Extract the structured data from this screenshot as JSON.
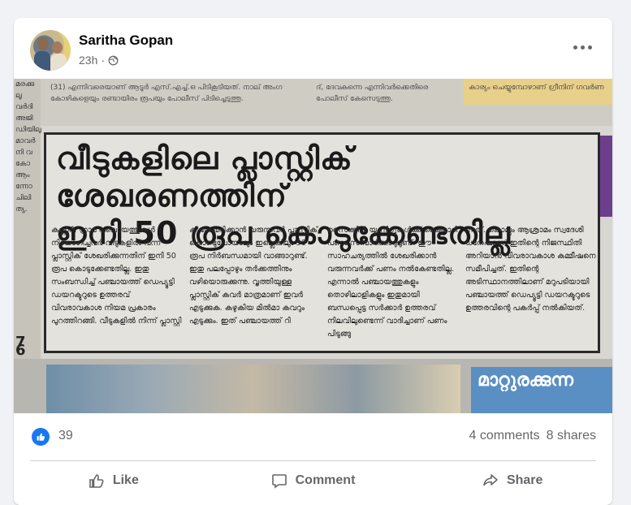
{
  "post": {
    "author": "Saritha Gopan",
    "time": "23h",
    "separator": "·",
    "privacy_icon": "globe-icon",
    "more_icon": "ellipsis-icon"
  },
  "newspaper": {
    "headline_line1": "വീടുകളിലെ പ്ലാസ്റ്റിക് ശേഖരണത്തിന്",
    "headline_line2": "ഇനി 50 രൂപ കൊടുക്കേണ്ടതില്ല",
    "top_snippet_left": "(31) എന്നിവരെയാണ് ആടൂർ എസ്.എച്ച്.ഒ പിടികൂടിയത്. നാല് അംഗ കോഴികളെയും രണ്ടായിരം രൂപയും പോലീസ് പിടിച്ചെടുത്തു.",
    "top_snippet_mid": "ദ്, ദേവകന്നെ എന്നിവർക്കെതിരെ പോലീസ് കേസെടുത്തു.",
    "top_snippet_right": "കാര്യം ചെയ്യുമ്പോഴാണ് ഗ്രീനിന് ഗവർണ",
    "col1": "കണ്ണൂർ: ഗ്രാമ പഞ്ചായത്തുകൾ നിയോഗിച്ചവർ വീടുകളിൽ വന്ന് പ്ലാസ്റ്റിക് ശേഖരിക്കുന്നതിന് ഇനി 50 രൂപ കൊടുക്കേണ്ടതില്ല. ഇതു സംബന്ധിച്ച് പഞ്ചായത്ത് ഡെപ്യൂട്ടി ഡയറക്ടറുടെ ഉത്തരവ് വിവരാവകാശ നിയമ പ്രകാരം പുറത്തിറങ്ങി. വീടുകളിൽ നിന്ന് പ്ലാസ്റ്റി",
    "col2": "ക് ശേഖരിക്കാൻ വരുന്നവർ പ്ലാസ്റ്റിക് കൊണ്ടുപോയാലും ഇല്ലെങ്കിലും 50 രൂപ നിർബന്ധമായി വാങ്ങാറുണ്ട്. ഇതു പലപ്പോഴും തർക്കത്തിനും വഴിയൊരുക്കുന്നു. വൃത്തിയുള്ള പ്ലാസ്റ്റിക് കവർ മാത്രമാണ് ഇവർ എടുക്കുക. കഴുകിയ മിൽമാ കവറും എടുക്കും. ഇത് പഞ്ചായത്ത് റി",
    "col3": "സൈക്കിൾ യൂണിറ്റുകൾക്ക് കൈമാറി പണം സമ്പാദിക്കാറുമുണ്ട്. ഈ സാഹചര്യത്തിൽ ശേഖരിക്കാൻ വരുന്നവർക്ക് പണം നൽകേണ്ടതില്ല. എന്നാൽ പഞ്ചായത്തുകളും തൊഴിലാളികളും ഇതുമായി ബന്ധപ്പെട്ട സർക്കാർ ഉത്തരവ് നിലവിലുണ്ടെന്ന് വാദിച്ചാണ് പണം പിടുങ്ങു",
    "col4": "ന്നത്. കൊല്ലം ആശ്രാമം സ്വദേശി ധനേഷാണ് ഇതിന്റെ നിജസ്ഥിതി അറിയാൻ വിവരാവകാശ കമ്മീഷനെ സമീപിച്ചത്. ഇതിന്റെ അടിസ്ഥാനത്തിലാണ് മറുപടിയായി പഞ്ചായത്ത് ഡെപ്യൂട്ടി ഡയറക്ടറുടെ ഉത്തരവിന്റെ പകർപ്പ് നൽകിയത്.",
    "edge_text": [
      "മരക്കു",
      "ലൂ വർദി",
      "അജി",
      "ഡിയിലു",
      "മാവർ",
      "നി വ",
      "കോ",
      "ആം",
      "ന്നോ",
      "ചിലി",
      "ത്യ."
    ],
    "edge_num1": "7",
    "edge_num2": "6",
    "bottom_right_text": "മാറ്റുരക്കുന്ന"
  },
  "stats": {
    "reaction_icon": "thumbs-up-icon",
    "likes": "39",
    "comments": "4 comments",
    "shares": "8 shares"
  },
  "actions": {
    "like": "Like",
    "comment": "Comment",
    "share": "Share"
  },
  "colors": {
    "accent": "#1877f2",
    "muted": "#65676b"
  }
}
